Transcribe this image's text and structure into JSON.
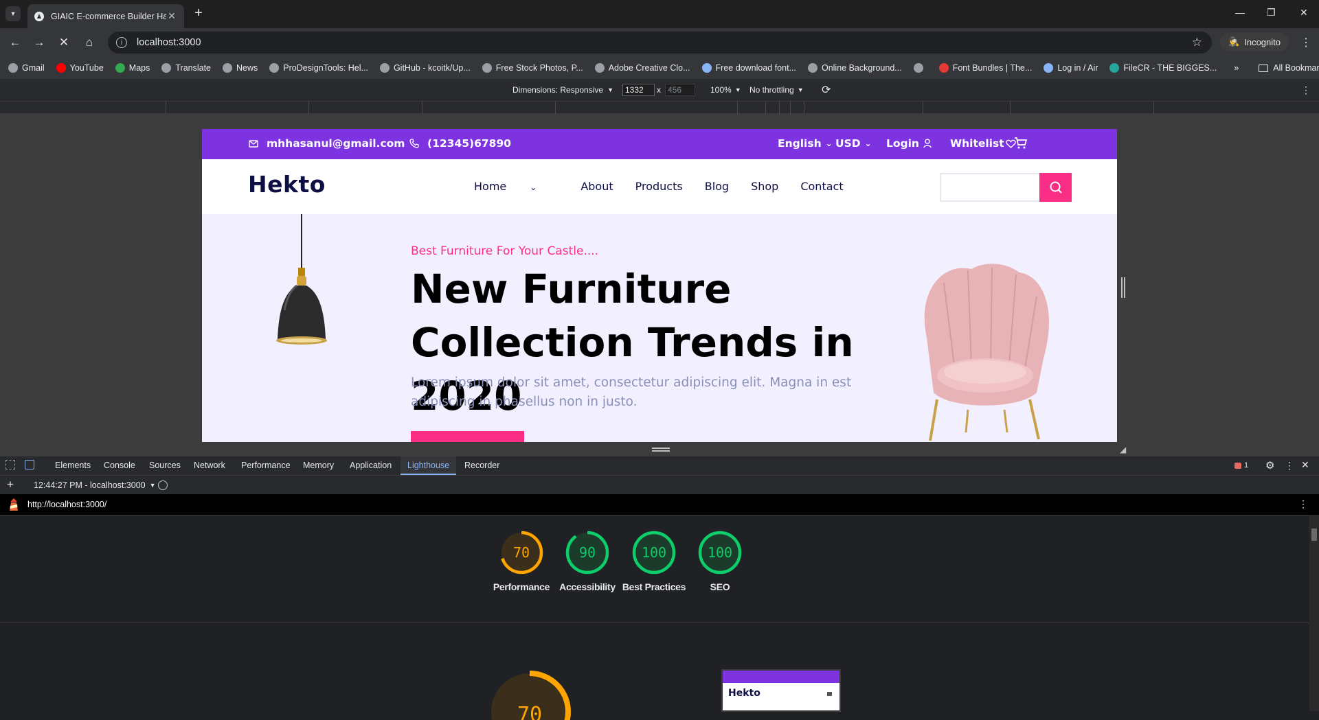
{
  "browser": {
    "tab_title": "GIAIC E-commerce Builder Hack",
    "url": "localhost:3000",
    "incognito_label": "Incognito",
    "bookmarks": [
      {
        "label": "Gmail",
        "icon": "globe-icon",
        "color": "#9aa0a6"
      },
      {
        "label": "YouTube",
        "icon": "youtube-icon",
        "color": "#ff0000"
      },
      {
        "label": "Maps",
        "icon": "maps-icon",
        "color": "#34a853"
      },
      {
        "label": "Translate",
        "icon": "globe-icon",
        "color": "#9aa0a6"
      },
      {
        "label": "News",
        "icon": "globe-icon",
        "color": "#9aa0a6"
      },
      {
        "label": "ProDesignTools: Hel...",
        "icon": "globe-icon",
        "color": "#9aa0a6"
      },
      {
        "label": "GitHub - kcoitk/Up...",
        "icon": "globe-icon",
        "color": "#9aa0a6"
      },
      {
        "label": "Free Stock Photos, P...",
        "icon": "globe-icon",
        "color": "#9aa0a6"
      },
      {
        "label": "Adobe Creative Clo...",
        "icon": "globe-icon",
        "color": "#9aa0a6"
      },
      {
        "label": "Free download font...",
        "icon": "wordpress-icon",
        "color": "#8ab4f8"
      },
      {
        "label": "Online Background...",
        "icon": "globe-icon",
        "color": "#9aa0a6"
      },
      {
        "label": "",
        "icon": "globe-icon",
        "color": "#9aa0a6"
      },
      {
        "label": "Font Bundles | The...",
        "icon": "fontbundles-icon",
        "color": "#e53935"
      },
      {
        "label": "Log in / Air",
        "icon": "air-icon",
        "color": "#8ab4f8"
      },
      {
        "label": "FileCR - THE BIGGES...",
        "icon": "filecr-icon",
        "color": "#26a69a"
      }
    ],
    "all_bookmarks_label": "All Bookmarks"
  },
  "device_toolbar": {
    "dimensions_label": "Dimensions: Responsive",
    "width": "1332",
    "times": "x",
    "height": "456",
    "zoom": "100%",
    "throttling": "No throttling"
  },
  "site": {
    "email": "mhhasanul@gmail.com",
    "phone": "(12345)67890",
    "language": "English",
    "currency": "USD",
    "login": "Login",
    "wishlist": "Whitelist",
    "logo": "Hekto",
    "nav": [
      "Home",
      "About",
      "Products",
      "Blog",
      "Shop",
      "Contact"
    ],
    "hero_tag": "Best Furniture For Your Castle....",
    "hero_title": "New Furniture Collection Trends in 2020",
    "hero_text": "Lorem ipsum dolor sit amet, consectetur adipiscing elit. Magna in est adipiscing in phasellus non in justo.",
    "colors": {
      "primary": "#7e33e0",
      "accent": "#fb2e86",
      "navy": "#0d0e43",
      "hero_bg": "#f2f0ff"
    }
  },
  "devtools": {
    "tabs": [
      "Elements",
      "Console",
      "Sources",
      "Network",
      "Performance",
      "Memory",
      "Application",
      "Lighthouse",
      "Recorder"
    ],
    "active_tab": "Lighthouse",
    "issues_count": "1",
    "report_time": "12:44:27 PM - localhost:3000",
    "report_url": "http://localhost:3000/",
    "scores": [
      {
        "label": "Performance",
        "value": 70,
        "color": "#ffa400"
      },
      {
        "label": "Accessibility",
        "value": 90,
        "color": "#0cce6b"
      },
      {
        "label": "Best Practices",
        "value": 100,
        "color": "#0cce6b"
      },
      {
        "label": "SEO",
        "value": 100,
        "color": "#0cce6b"
      }
    ],
    "big_score": 70,
    "thumb_logo": "Hekto"
  }
}
